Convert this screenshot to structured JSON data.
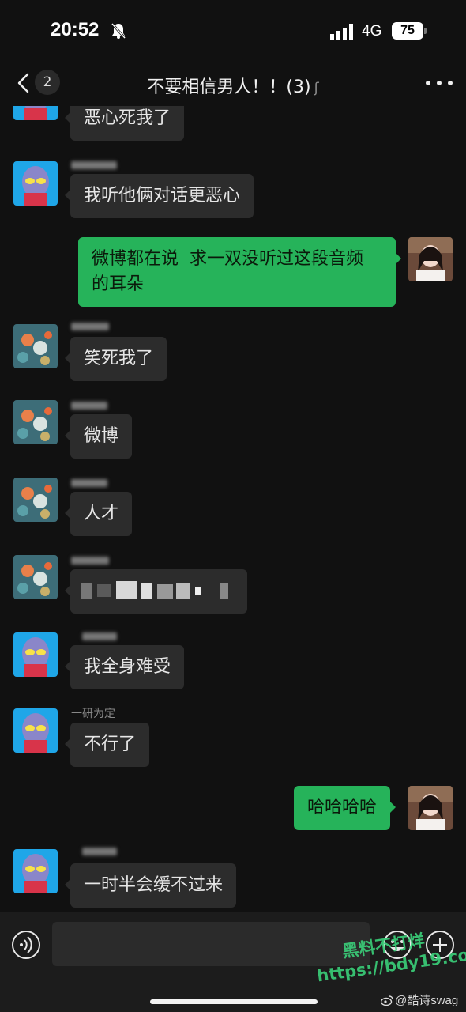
{
  "status_bar": {
    "time": "20:52",
    "network": "4G",
    "battery": "75"
  },
  "header": {
    "back_count": "2",
    "title": "不要相信男人！！(3)"
  },
  "messages": [
    {
      "side": "left",
      "avatar": "ultraman-avatar",
      "text": "恶心死我了"
    },
    {
      "side": "left",
      "avatar": "ultraman-avatar",
      "text": "我听他俩对话更恶心"
    },
    {
      "side": "right",
      "avatar": "girl-avatar",
      "text": "微博都在说  求一双没听过这段音频\n的耳朵"
    },
    {
      "side": "left",
      "avatar": "fish-painting-avatar",
      "text": "笑死我了"
    },
    {
      "side": "left",
      "avatar": "fish-painting-avatar",
      "text": "微博"
    },
    {
      "side": "left",
      "avatar": "fish-painting-avatar",
      "text": "人才"
    },
    {
      "side": "left",
      "avatar": "fish-painting-avatar",
      "text": ""
    },
    {
      "side": "left",
      "avatar": "ultraman-avatar",
      "text": "我全身难受"
    },
    {
      "side": "left",
      "avatar": "ultraman-avatar",
      "nickname": "一研为定",
      "text": "不行了"
    },
    {
      "side": "right",
      "avatar": "girl-avatar",
      "text": "哈哈哈哈"
    },
    {
      "side": "left",
      "avatar": "ultraman-avatar",
      "text": "一时半会缓不过来"
    }
  ],
  "input": {
    "value": ""
  },
  "watermark": {
    "line1": "黑料不打烊",
    "line2": "https://bdy19.co"
  },
  "credit": "@酷诗swag",
  "colors": {
    "background": "#111111",
    "bubble_left": "#2c2c2c",
    "bubble_right": "#26b35a"
  }
}
